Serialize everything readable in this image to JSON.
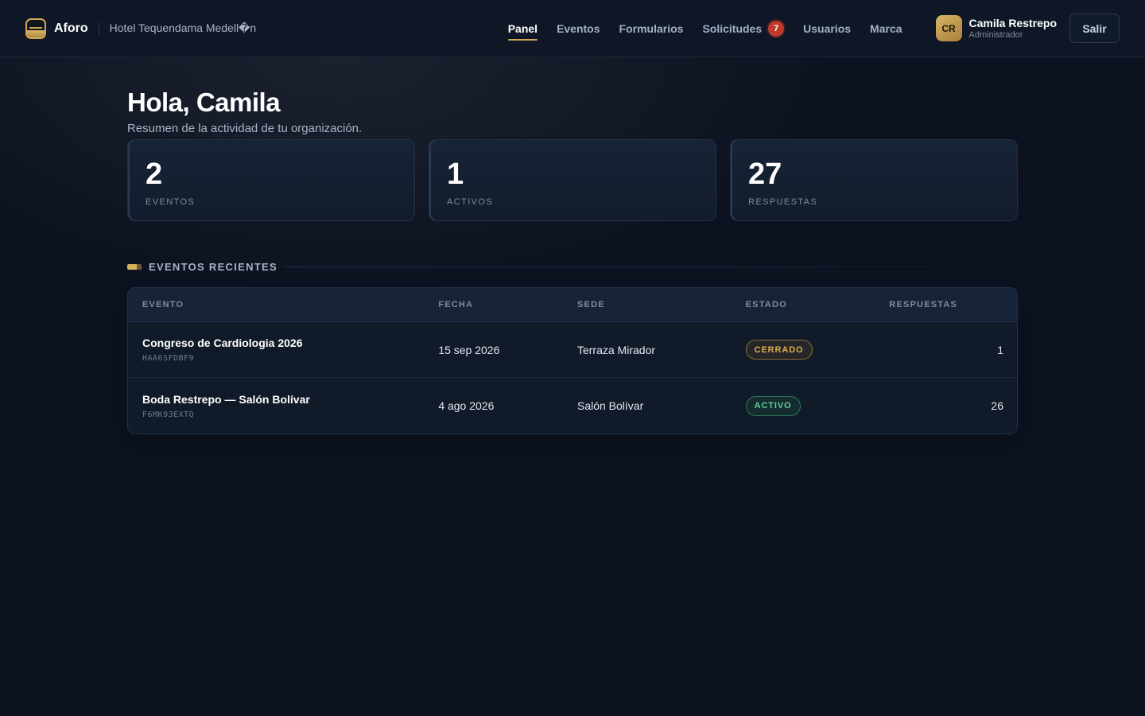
{
  "header": {
    "brand": "Aforo",
    "organization": "Hotel Tequendama Medell�n",
    "nav": [
      {
        "label": "Panel",
        "active": true
      },
      {
        "label": "Eventos"
      },
      {
        "label": "Formularios"
      },
      {
        "label": "Solicitudes",
        "badge": "7"
      },
      {
        "label": "Usuarios"
      },
      {
        "label": "Marca"
      }
    ],
    "user": {
      "initials": "CR",
      "name": "Camila Restrepo",
      "role": "Administrador"
    },
    "logout_label": "Salir"
  },
  "main": {
    "greeting": "Hola, Camila",
    "subtitle": "Resumen de la actividad de tu organización.",
    "stats": [
      {
        "value": "2",
        "label": "EVENTOS"
      },
      {
        "value": "1",
        "label": "ACTIVOS"
      },
      {
        "value": "27",
        "label": "RESPUESTAS"
      }
    ],
    "recent": {
      "title": "EVENTOS RECIENTES",
      "columns": [
        "EVENTO",
        "FECHA",
        "SEDE",
        "ESTADO",
        "RESPUESTAS"
      ],
      "rows": [
        {
          "name": "Congreso de Cardiologia 2026",
          "code": "HAA6SFDBF9",
          "date": "15 sep 2026",
          "venue": "Terraza Mirador",
          "status": "CERRADO",
          "status_color": "#e2ac4e",
          "responses": "1"
        },
        {
          "name": "Boda Restrepo — Salón Bolívar",
          "code": "F6MK93EXTQ",
          "date": "4 ago 2026",
          "venue": "Salón Bolívar",
          "status": "ACTIVO",
          "status_color": "#5fd193",
          "responses": "26"
        }
      ]
    }
  },
  "colors": {
    "accent": "#cfa85a",
    "background": "#0c1220",
    "badge": "#c0392b"
  }
}
